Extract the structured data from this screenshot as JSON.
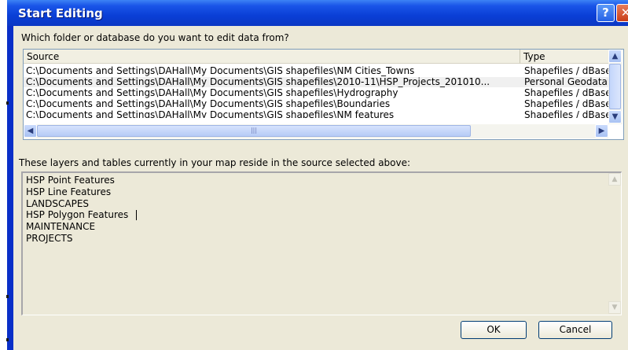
{
  "window": {
    "title": "Start Editing",
    "help_glyph": "?",
    "close_glyph": "✕"
  },
  "prompt_label": "Which folder or database do you want to edit data from?",
  "source_list": {
    "columns": [
      "Source",
      "Type"
    ],
    "rows": [
      {
        "source": "C:\\Documents and Settings\\DAHall\\My Documents\\GIS shapefiles\\NM Cities_Towns",
        "type": "Shapefiles / dBase"
      },
      {
        "source": "C:\\Documents and Settings\\DAHall\\My Documents\\GIS shapefiles\\2010-11\\HSP_Projects_201010...",
        "type": "Personal Geodatabase"
      },
      {
        "source": "C:\\Documents and Settings\\DAHall\\My Documents\\GIS shapefiles\\Hydrography",
        "type": "Shapefiles / dBase"
      },
      {
        "source": "C:\\Documents and Settings\\DAHall\\My Documents\\GIS shapefiles\\Boundaries",
        "type": "Shapefiles / dBase"
      },
      {
        "source": "C:\\Documents and Settings\\DAHall\\My Documents\\GIS shapefiles\\NM features",
        "type": "Shapefiles / dBase"
      }
    ],
    "selected_row": 1
  },
  "layers_label": "These layers and tables currently in your map reside in the source selected above:",
  "layers": [
    "HSP Point Features",
    "HSP Line Features",
    "LANDSCAPES",
    "HSP Polygon Features",
    "MAINTENANCE",
    "PROJECTS"
  ],
  "buttons": {
    "ok": "OK",
    "cancel": "Cancel"
  },
  "glyphs": {
    "up": "▲",
    "down": "▼",
    "left": "◀",
    "right": "▶",
    "grip": "|||"
  },
  "colors": {
    "title_bar": "#0b3fd6",
    "dialog_bg": "#ece9d8",
    "selection": "#f0f0f0"
  }
}
